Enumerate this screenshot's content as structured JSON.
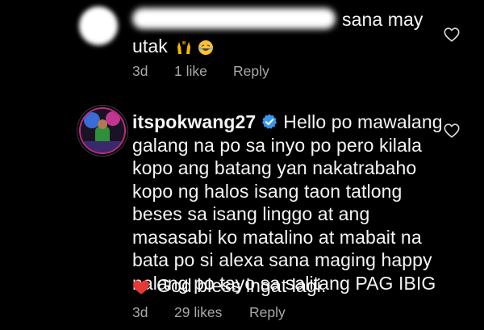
{
  "comments": [
    {
      "text_tail": "sana may",
      "text_line2": "utak",
      "emojis": [
        "raising-hands",
        "laughing"
      ],
      "meta": {
        "age": "3d",
        "likes": "1 like",
        "reply": "Reply"
      }
    },
    {
      "username": "itspokwang27",
      "lines": [
        "Hello po mawalang",
        "galang na po sa inyo po pero kilala",
        "kopo ang batang yan nakatrabaho",
        "kopo ng halos isang taon tatlong",
        "beses sa isang linggo at ang",
        "masasabi ko matalino at mabait na",
        "bata po si alexa sana maging happy",
        "nalang po tayo sa salitang PAG IBIG",
        "God bless ingat lagi."
      ],
      "emoji": "red-heart",
      "meta": {
        "age": "3d",
        "likes": "29 likes",
        "reply": "Reply"
      }
    }
  ],
  "colors": {
    "background": "#000000",
    "text": "#f5f5f5",
    "muted": "#a8a8a8",
    "verified": "#3897f0"
  },
  "icons": [
    "heart-outline-icon",
    "verified-badge-icon",
    "raising-hands-emoji",
    "laughing-emoji",
    "red-heart-emoji"
  ]
}
